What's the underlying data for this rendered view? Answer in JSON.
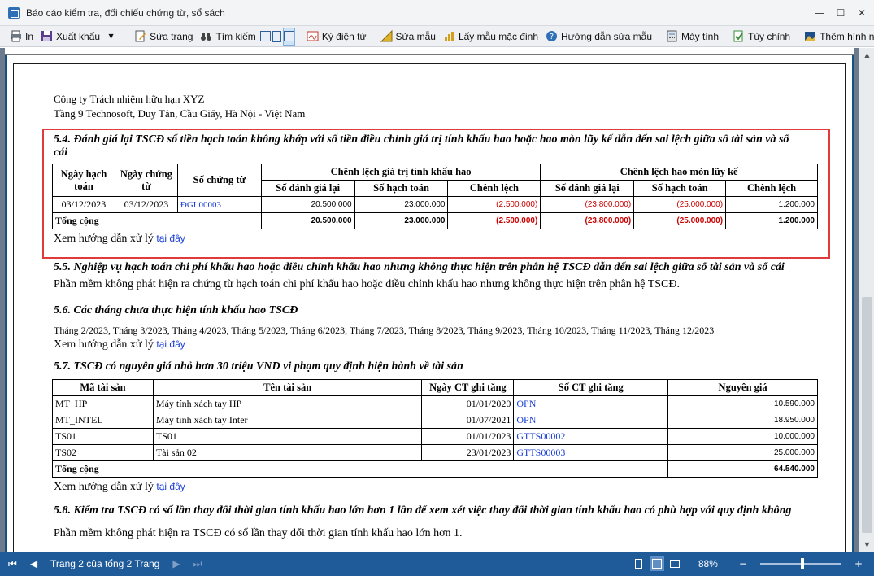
{
  "window": {
    "title": "Báo cáo kiểm tra, đối chiếu chứng từ, sổ sách",
    "minimize": "—",
    "maximize": "☐",
    "close": "✕"
  },
  "toolbar": {
    "print": "In",
    "export": "Xuất khẩu",
    "edit_page": "Sửa trang",
    "search": "Tìm kiếm",
    "e_sign": "Ký điện tử",
    "edit_template": "Sửa mẫu",
    "default_template": "Lấy mẫu mặc định",
    "guide": "Hướng dẫn sửa mẫu",
    "calculator": "Máy tính",
    "options": "Tùy chỉnh",
    "background": "Thêm hình nền"
  },
  "header": {
    "company": "Công ty Trách nhiệm hữu hạn XYZ",
    "address": "Tầng 9 Technosoft, Duy Tân, Cầu Giấy, Hà Nội - Việt Nam"
  },
  "s54": {
    "title_line1": "5.4. Đánh giá lại TSCĐ số tiền hạch toán không khớp với số tiền điều chỉnh giá trị tính khấu hao hoặc hao mòn lũy kế dẫn đến sai lệch giữa sổ tài sản và sổ",
    "title_line2": "cái",
    "cols": {
      "date_acc": "Ngày hạch toán",
      "date_doc": "Ngày chứng từ",
      "doc_no": "Số chứng từ",
      "group1": "Chênh lệch giá trị tính khấu hao",
      "group2": "Chênh lệch hao mòn lũy kế",
      "revalue": "Số đánh giá lại",
      "booked": "Số hạch toán",
      "diff": "Chênh lệch"
    },
    "row": {
      "date_acc": "03/12/2023",
      "date_doc": "03/12/2023",
      "doc_no": "ĐGL00003",
      "v1": "20.500.000",
      "v2": "23.000.000",
      "v3": "(2.500.000)",
      "v4": "(23.800.000)",
      "v5": "(25.000.000)",
      "v6": "1.200.000"
    },
    "total": {
      "label": "Tổng cộng",
      "v1": "20.500.000",
      "v2": "23.000.000",
      "v3": "(2.500.000)",
      "v4": "(23.800.000)",
      "v5": "(25.000.000)",
      "v6": "1.200.000"
    },
    "guide": "Xem hướng dẫn xử lý",
    "guide_link": "tại đây"
  },
  "s55": {
    "title": "5.5. Nghiệp vụ hạch toán chi phí khấu hao hoặc điều chỉnh khấu hao nhưng không thực hiện trên phân hệ TSCĐ dẫn đến sai lệch giữa sổ tài sản và sổ cái",
    "text": "Phần mềm không phát hiện ra chứng từ hạch toán chi phí khấu hao hoặc điều chỉnh khấu hao nhưng không thực hiện trên phân hệ TSCĐ."
  },
  "s56": {
    "title": "5.6. Các tháng chưa thực hiện tính khấu hao TSCĐ",
    "months": "Tháng 2/2023, Tháng 3/2023, Tháng 4/2023, Tháng 5/2023, Tháng 6/2023, Tháng 7/2023, Tháng 8/2023, Tháng 9/2023, Tháng 10/2023, Tháng 11/2023, Tháng 12/2023",
    "guide": "Xem hướng dẫn xử lý",
    "guide_link": "tại đây"
  },
  "s57": {
    "title": "5.7. TSCĐ có nguyên giá nhỏ hơn 30 triệu VND vi phạm quy định hiện hành về tài sản",
    "cols": [
      "Mã tài sản",
      "Tên tài sản",
      "Ngày CT ghi tăng",
      "Số CT ghi tăng",
      "Nguyên giá"
    ],
    "rows": [
      [
        "MT_HP",
        "Máy tính xách tay HP",
        "01/01/2020",
        "OPN",
        "10.590.000"
      ],
      [
        "MT_INTEL",
        "Máy tính xách tay Inter",
        "01/07/2021",
        "OPN",
        "18.950.000"
      ],
      [
        "TS01",
        "TS01",
        "01/01/2023",
        "GTTS00002",
        "10.000.000"
      ],
      [
        "TS02",
        "Tài sản 02",
        "23/01/2023",
        "GTTS00003",
        "25.000.000"
      ]
    ],
    "total_label": "Tổng cộng",
    "total_value": "64.540.000",
    "guide": "Xem hướng dẫn xử lý",
    "guide_link": "tại đây"
  },
  "s58": {
    "title": "5.8. Kiểm tra TSCĐ có số lần thay đổi thời gian tính khấu hao lớn hơn 1 lần để xem xét việc thay đổi thời gian tính khấu hao có phù hợp với quy định không",
    "text": "Phần mềm không phát hiện ra TSCĐ có số lần thay đổi thời gian tính khấu hao lớn hơn 1."
  },
  "status": {
    "page_info": "Trang 2 của tổng 2 Trang",
    "zoom": "88%",
    "zoom_minus": "−",
    "zoom_plus": "+"
  }
}
